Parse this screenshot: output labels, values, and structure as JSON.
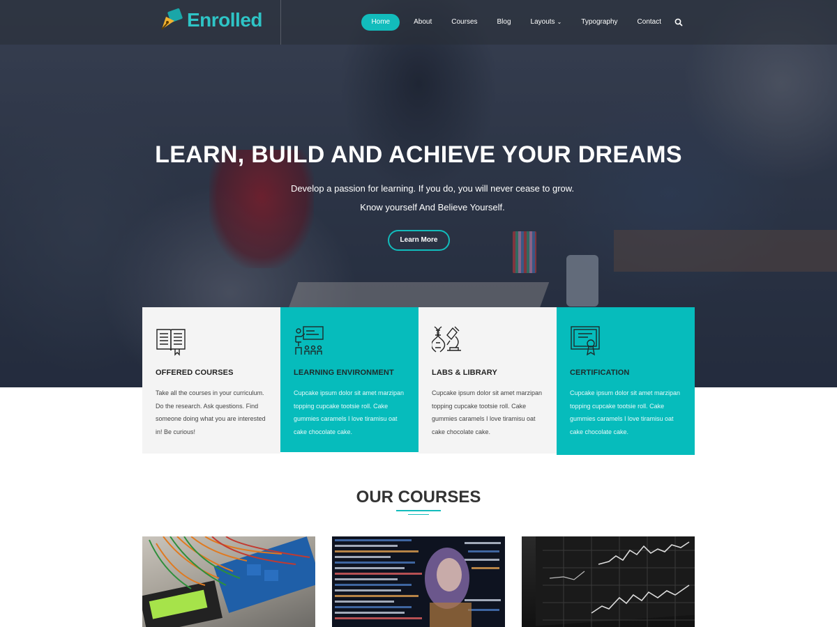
{
  "brand": {
    "name": "Enrolled",
    "accent": "#12bcbc"
  },
  "nav": {
    "items": [
      "Home",
      "About",
      "Courses",
      "Blog",
      "Layouts",
      "Typography",
      "Contact"
    ],
    "active": "Home"
  },
  "hero": {
    "title": "LEARN, BUILD AND ACHIEVE YOUR DREAMS",
    "subtitle_line1": "Develop a passion for learning. If you do, you will never cease to grow.",
    "subtitle_line2": "Know yourself And Believe Yourself.",
    "button": "Learn More"
  },
  "features": [
    {
      "icon": "book-icon",
      "title": "OFFERED COURSES",
      "text": "Take all the courses in your curriculum. Do the research. Ask questions. Find someone doing what you are interested in! Be curious!"
    },
    {
      "icon": "classroom-icon",
      "title": "LEARNING ENVIRONMENT",
      "text": "Cupcake ipsum dolor sit amet marzipan topping cupcake tootsie roll. Cake gummies caramels I love tiramisu oat cake chocolate cake."
    },
    {
      "icon": "dna-microscope-icon",
      "title": "LABS & LIBRARY",
      "text": "Cupcake ipsum dolor sit amet marzipan topping cupcake tootsie roll. Cake gummies caramels I love tiramisu oat cake chocolate cake."
    },
    {
      "icon": "certificate-icon",
      "title": "CERTIFICATION",
      "text": "Cupcake ipsum dolor sit amet marzipan topping cupcake tootsie roll. Cake gummies caramels I love tiramisu oat cake chocolate cake."
    }
  ],
  "courses_section": {
    "title": "OUR COURSES"
  }
}
